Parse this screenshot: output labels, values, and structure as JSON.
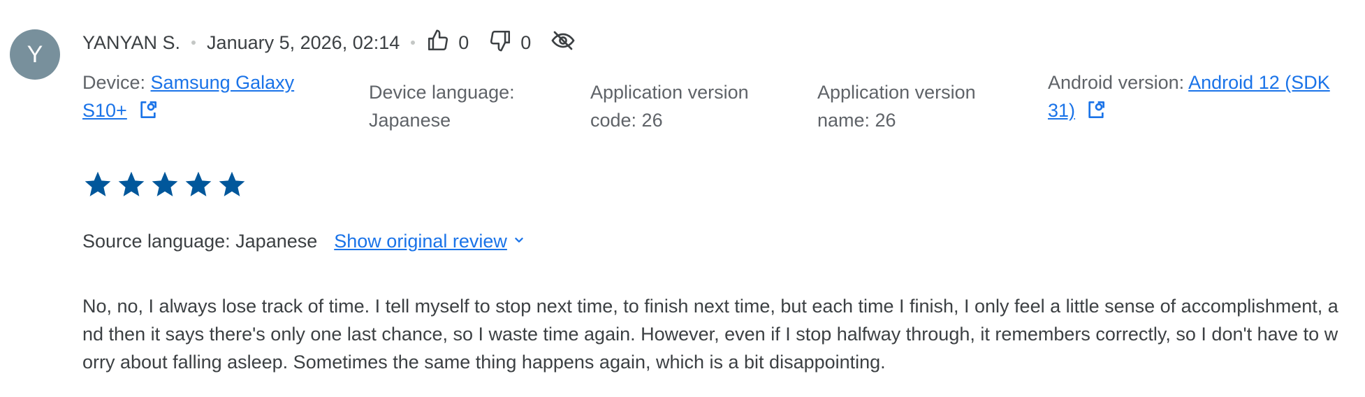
{
  "review": {
    "avatar_letter": "Y",
    "author": "YANYAN S.",
    "date": "January 5, 2026, 02:14",
    "thumbs_up_count": "0",
    "thumbs_down_count": "0",
    "rating": 5,
    "rating_max": 5,
    "star_color": "#01579b",
    "text": "No, no, I always lose track of time. I tell myself to stop next time, to finish next time, but each time I finish, I only feel a little sense of accomplishment, and then it says there's only one last chance, so I waste time again. However, even if I stop halfway through, it remembers correctly, so I don't have to worry about falling asleep. Sometimes the same thing happens again, which is a bit disappointing."
  },
  "metadata": {
    "device_label": "Device: ",
    "device_value": "Samsung Galaxy S10+",
    "device_language_label": "Device language:",
    "device_language_value": "Japanese",
    "app_version_code_label": "Application version code: 26",
    "app_version_name_label": "Application version name: 26",
    "android_version_label": "Android version: ",
    "android_version_value": "Android 12 (SDK 31)"
  },
  "translation": {
    "source_language": "Source language: Japanese",
    "show_original_label": "Show original review"
  },
  "icons": {
    "thumbs_up": "thumbs-up-icon",
    "thumbs_down": "thumbs-down-icon",
    "visibility_off": "visibility-off-icon",
    "open_in_new": "open-in-new-icon",
    "chevron_down": "chevron-down-icon",
    "star": "star-icon"
  },
  "colors": {
    "link": "#1a73e8",
    "avatar_bg": "#78909c",
    "star": "#01579b"
  }
}
